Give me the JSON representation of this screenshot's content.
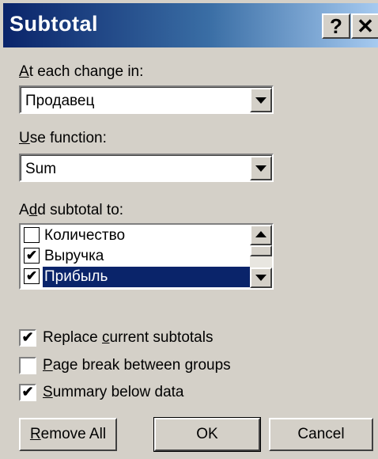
{
  "window": {
    "title": "Subtotal",
    "help_glyph": "?",
    "close_glyph": "✕"
  },
  "change_in": {
    "label_hotkey": "A",
    "label_rest": "t each change in:",
    "value": "Продавец"
  },
  "use_function": {
    "label_hotkey": "U",
    "label_rest": "se function:",
    "value": "Sum"
  },
  "add_subtotal": {
    "label_pre": "A",
    "label_hotkey": "d",
    "label_rest": "d subtotal to:",
    "items": [
      {
        "label": "Количество",
        "checked": "",
        "selected": false
      },
      {
        "label": "Выручка",
        "checked": "✔",
        "selected": false
      },
      {
        "label": "Прибыль",
        "checked": "✔",
        "selected": true
      }
    ]
  },
  "options": {
    "replace": {
      "checked": "✔",
      "label_pre": "Replace ",
      "label_hotkey": "c",
      "label_rest": "urrent subtotals"
    },
    "page_break": {
      "checked": "",
      "label_pre": "",
      "label_hotkey": "P",
      "label_rest": "age break between groups"
    },
    "summary": {
      "checked": "✔",
      "label_pre": "",
      "label_hotkey": "S",
      "label_rest": "ummary below data"
    }
  },
  "buttons": {
    "remove_all": {
      "hotkey": "R",
      "rest": "emove All"
    },
    "ok": "OK",
    "cancel": "Cancel"
  },
  "colors": {
    "title_start": "#0a246a",
    "title_end": "#a6caf0",
    "selection": "#0a246a",
    "face": "#d4d0c8"
  }
}
